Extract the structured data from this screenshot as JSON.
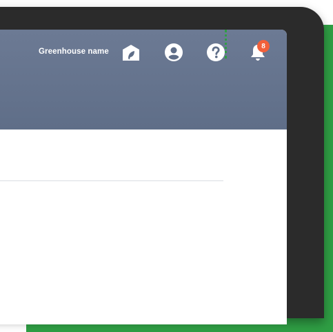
{
  "header": {
    "greenhouse_name": "Greenhouse name",
    "notification_count": "8"
  },
  "icons": {
    "greenhouse": "greenhouse-icon",
    "account": "account-icon",
    "help": "help-icon",
    "notifications": "bell-icon"
  },
  "colors": {
    "header": "#5f6e88",
    "accent_green": "#2f9e44",
    "badge": "#f2603a",
    "frame": "#2b2b2b"
  }
}
